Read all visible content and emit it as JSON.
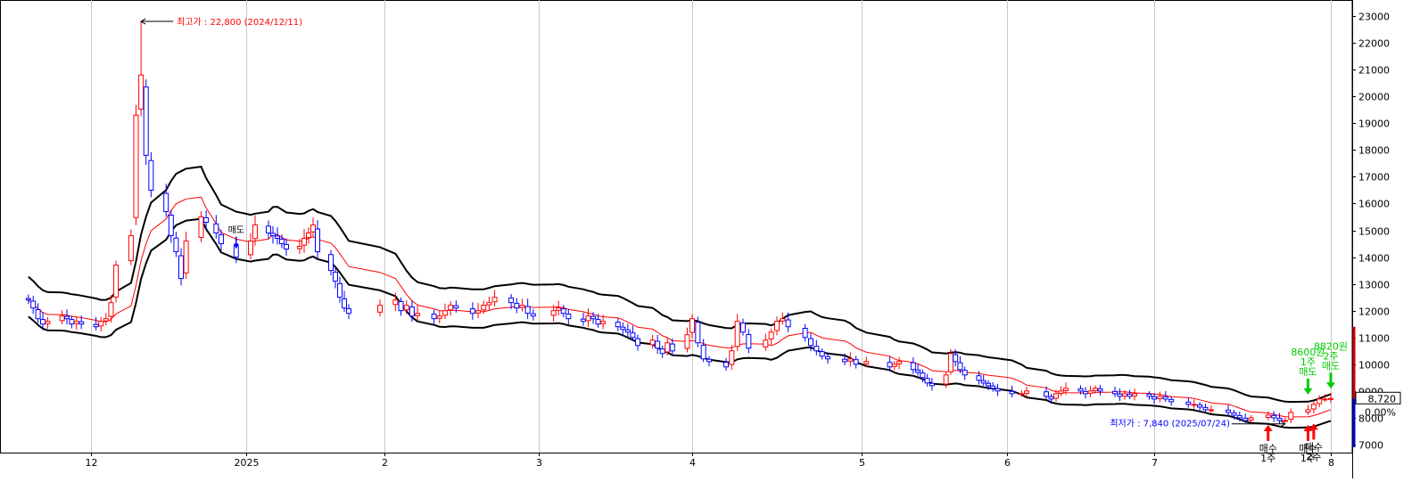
{
  "chart_data": {
    "type": "candlestick",
    "y_ticks": [
      7000,
      8000,
      9000,
      10000,
      11000,
      12000,
      13000,
      14000,
      15000,
      16000,
      17000,
      18000,
      19000,
      20000,
      21000,
      22000,
      23000
    ],
    "ylim": [
      6700,
      23600
    ],
    "x_labels": [
      {
        "label": "12",
        "date": "2024-12-01"
      },
      {
        "label": "2025",
        "date": "2025-01-01"
      },
      {
        "label": "2",
        "date": "2025-02-01"
      },
      {
        "label": "3",
        "date": "2025-03-01"
      },
      {
        "label": "4",
        "date": "2025-04-01"
      },
      {
        "label": "5",
        "date": "2025-05-01"
      },
      {
        "label": "6",
        "date": "2025-06-01"
      },
      {
        "label": "7",
        "date": "2025-07-01"
      },
      {
        "label": "8",
        "date": "2025-08-01"
      }
    ],
    "current_price_label": "8,720",
    "current_price": 8720,
    "change_label": "0.00%",
    "high_annotation": {
      "text": "최고가 : 22,800 (2024/12/11)",
      "value": 22800,
      "date": "2024-12-11"
    },
    "low_annotation": {
      "text": "최저가 : 7,840 (2025/07/24)",
      "value": 7840,
      "date": "2025-07-24"
    },
    "sell_signals": [
      {
        "lines": [
          "8600원",
          "1주",
          "매도"
        ],
        "date": "2025-07-28",
        "value": 8600
      },
      {
        "lines": [
          "8820원",
          "2주",
          "매도"
        ],
        "date": "2025-08-01",
        "value": 8820
      }
    ],
    "buy_signals": [
      {
        "lines": [
          "매수",
          "1주"
        ],
        "date": "2025-07-21",
        "value": 8000
      },
      {
        "lines": [
          "매수",
          "1주"
        ],
        "date": "2025-07-28",
        "value": 8000
      },
      {
        "lines": [
          "매수",
          "2주"
        ],
        "date": "2025-07-29",
        "value": 8050
      }
    ],
    "other_signal": {
      "lines": [
        "매도"
      ],
      "date": "2024-12-30",
      "value": 14300
    },
    "series": [
      {
        "role": "candles",
        "dates": [
          "2024-11-18",
          "2024-11-19",
          "2024-11-20",
          "2024-11-21",
          "2024-11-22",
          "2024-11-25",
          "2024-11-26",
          "2024-11-27",
          "2024-11-28",
          "2024-11-29",
          "2024-12-02",
          "2024-12-03",
          "2024-12-04",
          "2024-12-05",
          "2024-12-06",
          "2024-12-09",
          "2024-12-10",
          "2024-12-11",
          "2024-12-12",
          "2024-12-13",
          "2024-12-16",
          "2024-12-17",
          "2024-12-18",
          "2024-12-19",
          "2024-12-20",
          "2024-12-23",
          "2024-12-24",
          "2024-12-26",
          "2024-12-27",
          "2024-12-30",
          "2025-01-02",
          "2025-01-03",
          "2025-01-06",
          "2025-01-07",
          "2025-01-08",
          "2025-01-09",
          "2025-01-10",
          "2025-01-13",
          "2025-01-14",
          "2025-01-15",
          "2025-01-16",
          "2025-01-17",
          "2025-01-20",
          "2025-01-21",
          "2025-01-22",
          "2025-01-23",
          "2025-01-24",
          "2025-01-31",
          "2025-02-03",
          "2025-02-04",
          "2025-02-05",
          "2025-02-06",
          "2025-02-07",
          "2025-02-10",
          "2025-02-11",
          "2025-02-12",
          "2025-02-13",
          "2025-02-14",
          "2025-02-17",
          "2025-02-18",
          "2025-02-19",
          "2025-02-20",
          "2025-02-21",
          "2025-02-24",
          "2025-02-25",
          "2025-02-26",
          "2025-02-27",
          "2025-02-28",
          "2025-03-04",
          "2025-03-05",
          "2025-03-06",
          "2025-03-07",
          "2025-03-10",
          "2025-03-11",
          "2025-03-12",
          "2025-03-13",
          "2025-03-14",
          "2025-03-17",
          "2025-03-18",
          "2025-03-19",
          "2025-03-20",
          "2025-03-21",
          "2025-03-24",
          "2025-03-25",
          "2025-03-26",
          "2025-03-27",
          "2025-03-28",
          "2025-03-31",
          "2025-04-01",
          "2025-04-02",
          "2025-04-03",
          "2025-04-04",
          "2025-04-07",
          "2025-04-08",
          "2025-04-09",
          "2025-04-10",
          "2025-04-11",
          "2025-04-14",
          "2025-04-15",
          "2025-04-16",
          "2025-04-17",
          "2025-04-18",
          "2025-04-21",
          "2025-04-22",
          "2025-04-23",
          "2025-04-24",
          "2025-04-25",
          "2025-04-28",
          "2025-04-29",
          "2025-04-30",
          "2025-05-02",
          "2025-05-07",
          "2025-05-08",
          "2025-05-09",
          "2025-05-12",
          "2025-05-13",
          "2025-05-14",
          "2025-05-15",
          "2025-05-16",
          "2025-05-19",
          "2025-05-20",
          "2025-05-21",
          "2025-05-22",
          "2025-05-23",
          "2025-05-26",
          "2025-05-27",
          "2025-05-28",
          "2025-05-29",
          "2025-05-30",
          "2025-06-02",
          "2025-06-04",
          "2025-06-05",
          "2025-06-09",
          "2025-06-10",
          "2025-06-11",
          "2025-06-12",
          "2025-06-13",
          "2025-06-16",
          "2025-06-17",
          "2025-06-18",
          "2025-06-19",
          "2025-06-20",
          "2025-06-23",
          "2025-06-24",
          "2025-06-25",
          "2025-06-26",
          "2025-06-27",
          "2025-06-30",
          "2025-07-01",
          "2025-07-02",
          "2025-07-03",
          "2025-07-04",
          "2025-07-07",
          "2025-07-08",
          "2025-07-09",
          "2025-07-10",
          "2025-07-11",
          "2025-07-14",
          "2025-07-15",
          "2025-07-16",
          "2025-07-17",
          "2025-07-18",
          "2025-07-21",
          "2025-07-22",
          "2025-07-23",
          "2025-07-24",
          "2025-07-25",
          "2025-07-28",
          "2025-07-29",
          "2025-07-30",
          "2025-07-31",
          "2025-08-01"
        ],
        "close": [
          12400,
          12100,
          11700,
          11500,
          11600,
          11800,
          11700,
          11500,
          11600,
          11500,
          11400,
          11600,
          11700,
          12300,
          13700,
          14800,
          19300,
          20800,
          17800,
          16500,
          15700,
          14800,
          14200,
          13200,
          14600,
          15500,
          15300,
          14900,
          14500,
          14000,
          14600,
          15200,
          14900,
          14800,
          14700,
          14500,
          14300,
          14400,
          14700,
          14900,
          15200,
          14200,
          13500,
          13100,
          12500,
          12100,
          11900,
          12200,
          12400,
          12000,
          12200,
          11800,
          11900,
          11700,
          11800,
          12000,
          12200,
          12100,
          11900,
          12000,
          12200,
          12300,
          12500,
          12300,
          12100,
          12200,
          11900,
          11800,
          12000,
          12100,
          11900,
          11700,
          11600,
          11800,
          11700,
          11500,
          11600,
          11400,
          11300,
          11200,
          11000,
          10700,
          10900,
          10600,
          10400,
          10800,
          10500,
          11100,
          11700,
          10800,
          10200,
          10100,
          9900,
          10500,
          11600,
          11200,
          10600,
          10900,
          11200,
          11600,
          11700,
          11400,
          11000,
          10700,
          10500,
          10300,
          10200,
          10100,
          10200,
          10000,
          10100,
          9900,
          10000,
          10100,
          9800,
          9700,
          9500,
          9300,
          9200,
          9600,
          10400,
          10100,
          9800,
          9600,
          9400,
          9300,
          9200,
          9100,
          9000,
          8900,
          8900,
          9000,
          8800,
          8700,
          8900,
          9000,
          9100,
          9000,
          8900,
          9000,
          9100,
          9000,
          8900,
          8800,
          8900,
          8800,
          8900,
          8800,
          8700,
          8800,
          8700,
          8600,
          8500,
          8500,
          8400,
          8300,
          8300,
          8200,
          8100,
          8000,
          7900,
          8000,
          8100,
          8000,
          7900,
          7900,
          8200,
          8300,
          8500,
          8700,
          8700,
          8720
        ]
      },
      {
        "role": "moving-average",
        "name": "",
        "color": "#ff0000"
      },
      {
        "role": "band-upper",
        "name": "",
        "color": "#000000"
      },
      {
        "role": "band-lower",
        "name": "",
        "color": "#000000"
      }
    ],
    "title": "",
    "xlabel": "",
    "ylabel": "",
    "grid": true,
    "colors": {
      "up": "#ff0000",
      "down": "#0000ff",
      "band": "#000000",
      "ma": "#ff0000",
      "sell": "#00cc00",
      "buy": "#ff0000"
    }
  }
}
